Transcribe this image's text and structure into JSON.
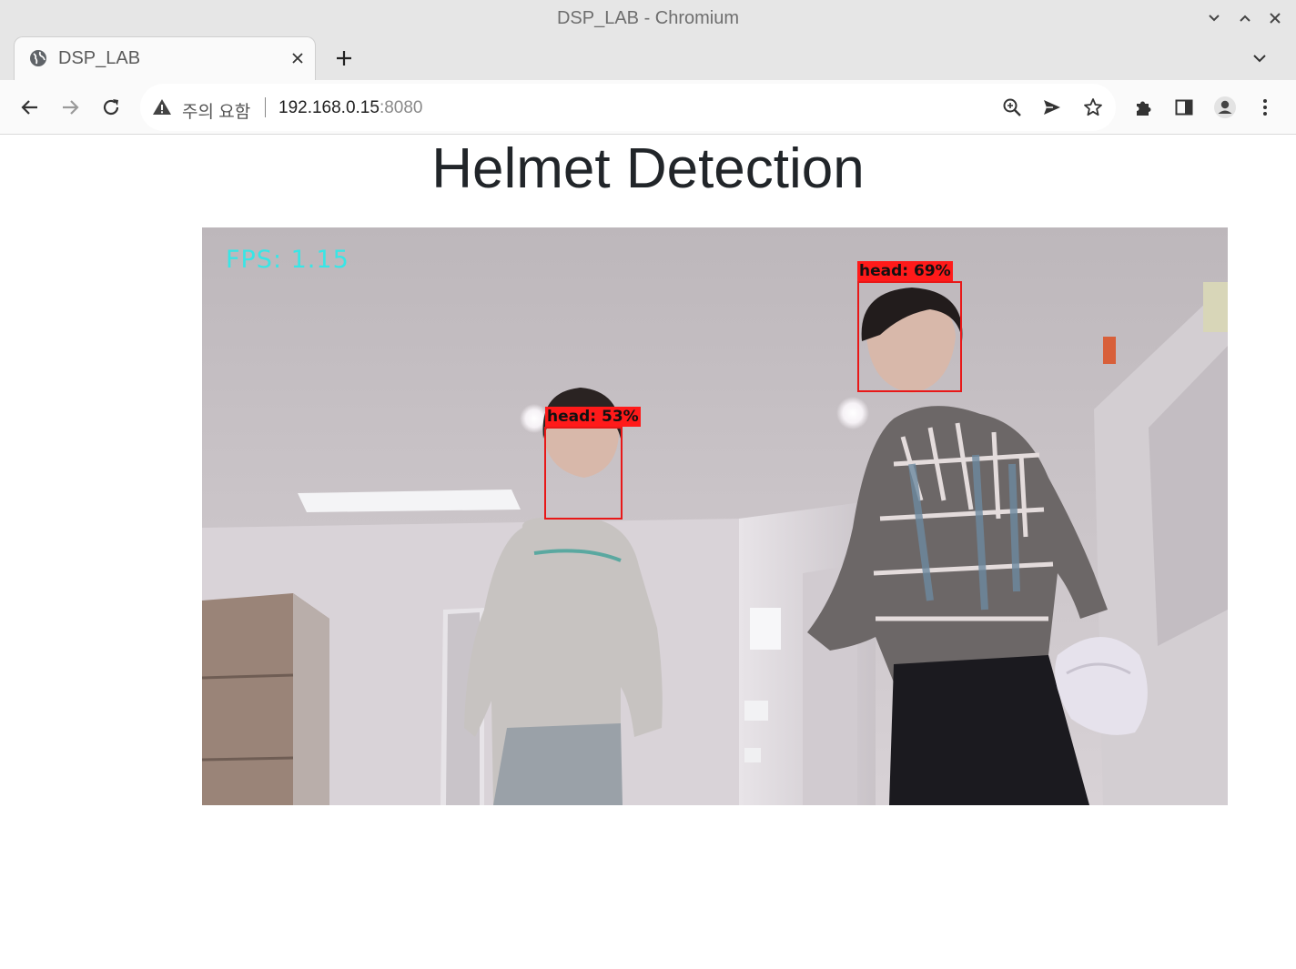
{
  "window": {
    "title": "DSP_LAB - Chromium"
  },
  "tab": {
    "title": "DSP_LAB"
  },
  "toolbar": {
    "security_label": "주의 요함",
    "url_host": "192.168.0.15",
    "url_port": ":8080"
  },
  "page": {
    "heading": "Helmet Detection",
    "video": {
      "fps_text": "FPS: 1.15",
      "detections": [
        {
          "label": "head: 53%"
        },
        {
          "label": "head: 69%"
        }
      ]
    }
  },
  "icons": {
    "minimize": "chevron-down-icon",
    "maximize": "chevron-up-icon",
    "close": "close-icon",
    "favicon": "globe-icon",
    "back": "arrow-left-icon",
    "forward": "arrow-right-icon",
    "reload": "reload-icon",
    "warning": "warning-icon",
    "zoom": "zoom-icon",
    "send": "send-icon",
    "bookmark": "star-icon",
    "extensions": "puzzle-icon",
    "side_panel": "side-panel-icon",
    "profile": "profile-icon",
    "menu": "kebab-menu-icon"
  },
  "colors": {
    "chrome_frame": "#e6e6e6",
    "toolbar": "#fafafa",
    "fps_text": "#38e6e6",
    "detection_box": "#e81818"
  }
}
